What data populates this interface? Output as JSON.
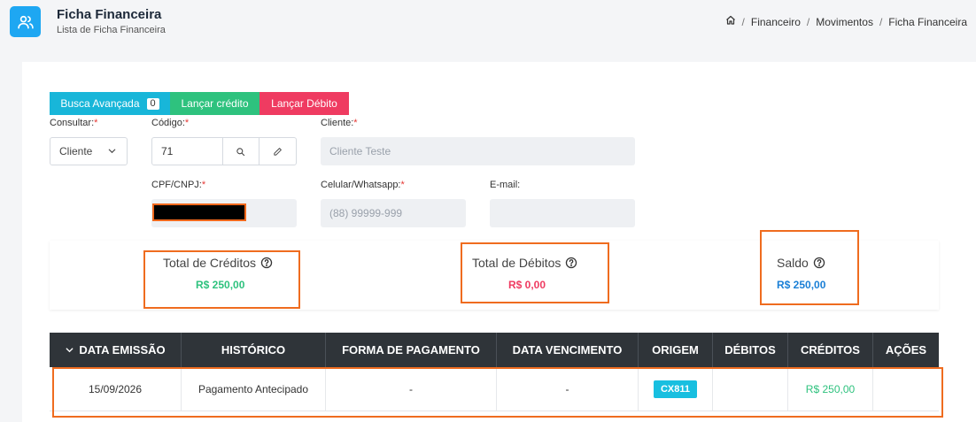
{
  "header": {
    "title": "Ficha Financeira",
    "subtitle": "Lista de Ficha Financeira",
    "app_icon": "users-icon",
    "breadcrumb": {
      "home_icon": "home-icon",
      "items": [
        "Financeiro",
        "Movimentos",
        "Ficha Financeira"
      ],
      "separator": "/"
    }
  },
  "actions": {
    "busca_label": "Busca Avançada",
    "busca_count": "0",
    "credito_label": "Lançar crédito",
    "debito_label": "Lançar Débito"
  },
  "form": {
    "consultar": {
      "label": "Consultar:",
      "required": "*",
      "value": "Cliente"
    },
    "codigo": {
      "label": "Código:",
      "required": "*",
      "value": "71"
    },
    "cliente": {
      "label": "Cliente:",
      "required": "*",
      "value": "Cliente Teste"
    },
    "cpf": {
      "label": "CPF/CNPJ:",
      "required": "*"
    },
    "celular": {
      "label": "Celular/Whatsapp:",
      "required": "*",
      "placeholder": "(88) 99999-999"
    },
    "email": {
      "label": "E-mail:",
      "value": ""
    }
  },
  "summary": {
    "creditos": {
      "title": "Total de Créditos",
      "value": "R$ 250,00",
      "color": "#2ec27e"
    },
    "debitos": {
      "title": "Total de Débitos",
      "value": "R$ 0,00",
      "color": "#ef3b61"
    },
    "saldo": {
      "title": "Saldo",
      "value": "R$ 250,00",
      "color": "#1a7fd6"
    }
  },
  "table": {
    "headers": [
      "DATA EMISSÃO",
      "HISTÓRICO",
      "FORMA DE PAGAMENTO",
      "DATA VENCIMENTO",
      "ORIGEM",
      "DÉBITOS",
      "CRÉDITOS",
      "AÇÕES"
    ],
    "rows": [
      {
        "data_emissao": "15/09/2026",
        "historico": "Pagamento Antecipado",
        "forma_pagamento": "-",
        "data_vencimento": "-",
        "origem": "CX811",
        "debitos": "",
        "creditos": "R$ 250,00",
        "acoes": ""
      }
    ]
  },
  "colors": {
    "primary": "#1ea7f2",
    "success": "#2ec27e",
    "danger": "#ef3b61",
    "info": "#18bfe0",
    "highlight": "#ef6c1f"
  }
}
